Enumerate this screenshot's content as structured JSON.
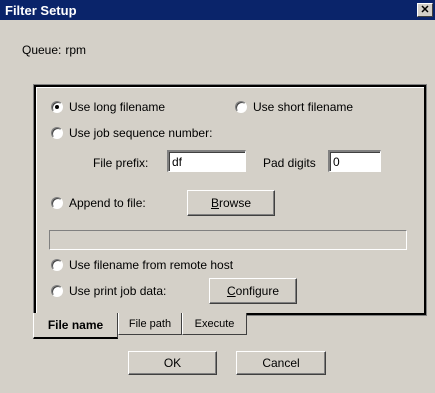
{
  "window": {
    "title": "Filter Setup",
    "close_glyph": "✕"
  },
  "queue": {
    "label": "Queue:",
    "value": "rpm"
  },
  "options": {
    "long_filename": "Use long filename",
    "short_filename": "Use short filename",
    "job_sequence": "Use job sequence number:",
    "file_prefix_label": "File prefix:",
    "file_prefix_value": "df",
    "pad_digits_label": "Pad digits",
    "pad_digits_value": "0",
    "append_to_file": "Append to file:",
    "browse_button": "Browse",
    "append_path_value": "",
    "remote_host": "Use filename from remote host",
    "print_job_data": "Use print job data:",
    "configure_button": "Configure",
    "selected": "long_filename"
  },
  "tabs": [
    {
      "label": "File name",
      "active": true
    },
    {
      "label": "File path",
      "active": false
    },
    {
      "label": "Execute",
      "active": false
    }
  ],
  "buttons": {
    "ok": "OK",
    "cancel": "Cancel"
  }
}
